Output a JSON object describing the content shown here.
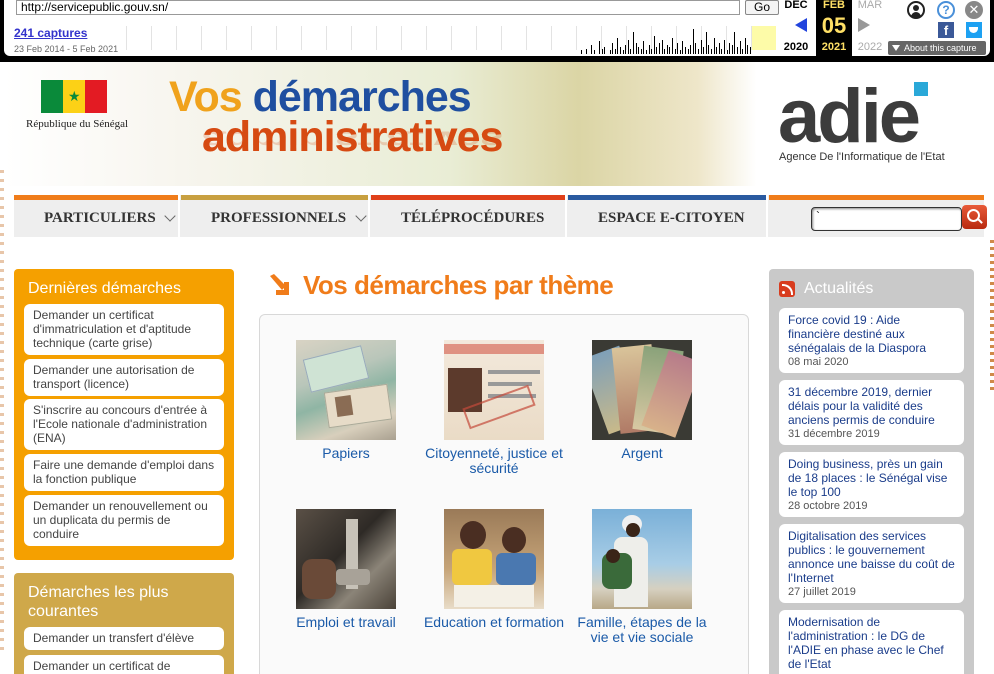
{
  "wayback": {
    "url": "http://servicepublic.gouv.sn/",
    "go_label": "Go",
    "captures": "241 captures",
    "range": "23 Feb 2014 - 5 Feb 2021",
    "prev_month": "DEC",
    "prev_year": "2020",
    "cur_month": "FEB",
    "cur_day": "05",
    "cur_year": "2021",
    "next_month": "MAR",
    "next_year": "2022",
    "about": "About this capture",
    "icons": [
      "user-icon",
      "help-icon",
      "close-icon",
      "facebook-icon",
      "twitter-icon"
    ]
  },
  "header": {
    "republique": "République du Sénégal",
    "title_line1_a": "Vos ",
    "title_line1_b": "démarches",
    "title_line2": "administratives",
    "logo": "adie",
    "logo_sub": "Agence De l'Informatique de l'Etat",
    "colors": {
      "blue": "#1f4fa0",
      "orange": "#d64a12",
      "yellow": "#f0a21c",
      "flag_green": "#0a8a3a",
      "flag_yellow": "#fcd116",
      "flag_red": "#e31b23"
    }
  },
  "nav": {
    "items": [
      {
        "label": "PARTICULIERS",
        "color": "#f07c1a",
        "dropdown": true
      },
      {
        "label": "PROFESSIONNELS",
        "color": "#c8a040",
        "dropdown": true
      },
      {
        "label": "TÉLÉPROCÉDURES",
        "color": "#e0401a",
        "dropdown": false
      },
      {
        "label": "ESPACE E-CITOYEN",
        "color": "#2a5aa0",
        "dropdown": false
      }
    ],
    "search_value": "`",
    "search_bar_color": "#f07c1a"
  },
  "sidebar": {
    "recent_title": "Dernières démarches",
    "recent": [
      "Demander un certificat d'immatriculation et d'aptitude technique (carte grise)",
      "Demander une autorisation de transport (licence)",
      "S'inscrire au concours d'entrée à l'Ecole nationale d'administration (ENA)",
      "Faire une demande d'emploi dans la fonction publique",
      "Demander un renouvellement ou un duplicata du permis de conduire"
    ],
    "common_title": "Démarches les plus courantes",
    "common": [
      "Demander un transfert d'élève",
      "Demander un certificat de"
    ]
  },
  "main": {
    "title": "Vos démarches par thème",
    "themes": [
      {
        "label": "Papiers",
        "icon": "id-cards-photo"
      },
      {
        "label": "Citoyenneté, justice et sécurité",
        "icon": "voter-card-photo"
      },
      {
        "label": "Argent",
        "icon": "banknotes-photo"
      },
      {
        "label": "Emploi et travail",
        "icon": "sewing-machine-photo"
      },
      {
        "label": "Education et formation",
        "icon": "children-reading-photo"
      },
      {
        "label": "Famille, étapes de la vie et vie sociale",
        "icon": "mother-child-photo"
      }
    ]
  },
  "news": {
    "title": "Actualités",
    "items": [
      {
        "title": "Force covid 19 : Aide financière destiné aux sénégalais de la Diaspora",
        "date": "08 mai 2020"
      },
      {
        "title": "31 décembre 2019, dernier délais pour la validité des anciens permis de conduire",
        "date": "31 décembre 2019"
      },
      {
        "title": "Doing business, près un gain de 18 places : le Sénégal vise le top 100",
        "date": "28 octobre 2019"
      },
      {
        "title": "Digitalisation des services publics : le gouvernement annonce une baisse du coût de l'Internet",
        "date": "27 juillet 2019"
      },
      {
        "title": "Modernisation de l'administration : le DG de l'ADIE en phase avec le Chef de l'Etat",
        "date": ""
      }
    ]
  }
}
